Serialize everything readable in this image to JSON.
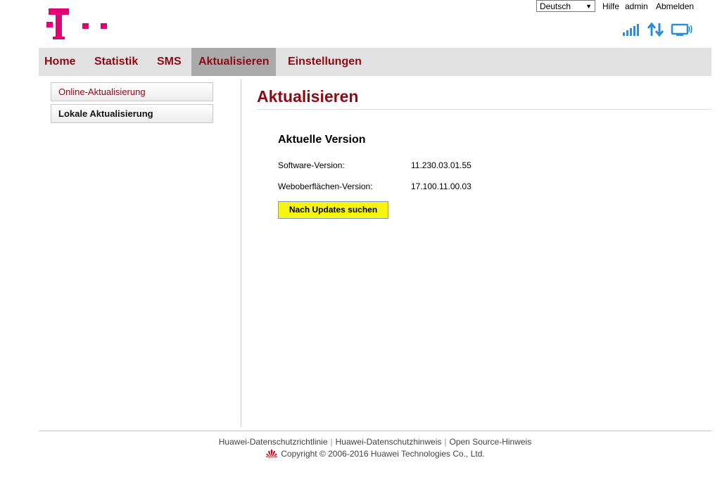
{
  "header": {
    "language": "Deutsch",
    "links": {
      "help": "Hilfe",
      "user": "admin",
      "logout": "Abmelden"
    },
    "logo": "telekom-t-logo",
    "status_icons": [
      "signal-strength-icon",
      "data-transfer-icon",
      "connected-device-icon"
    ]
  },
  "nav": {
    "items": [
      {
        "label": "Home",
        "active": false
      },
      {
        "label": "Statistik",
        "active": false
      },
      {
        "label": "SMS",
        "active": false
      },
      {
        "label": "Aktualisieren",
        "active": true
      },
      {
        "label": "Einstellungen",
        "active": false
      }
    ]
  },
  "sidebar": {
    "items": [
      {
        "label": "Online-Aktualisierung",
        "active": true
      },
      {
        "label": "Lokale Aktualisierung",
        "active": false
      }
    ]
  },
  "main": {
    "title": "Aktualisieren",
    "section_title": "Aktuelle Version",
    "rows": [
      {
        "label": "Software-Version:",
        "value": "11.230.03.01.55"
      },
      {
        "label": "Weboberflächen-Version:",
        "value": "17.100.11.00.03"
      }
    ],
    "check_button": "Nach Updates suchen"
  },
  "footer": {
    "links": [
      "Huawei-Datenschutzrichtlinie",
      "Huawei-Datenschutzhinweis",
      "Open Source-Hinweis"
    ],
    "separator": "|",
    "copyright": "Copyright © 2006-2016 Huawei Technologies Co., Ltd."
  },
  "colors": {
    "brand_magenta": "#e20074",
    "nav_text": "#8c0a15",
    "nav_bg": "#e1e1e1",
    "nav_active_bg": "#aaaaaa",
    "status_icon_blue": "#2a8fd4",
    "highlight_button": "#f5f50f"
  }
}
